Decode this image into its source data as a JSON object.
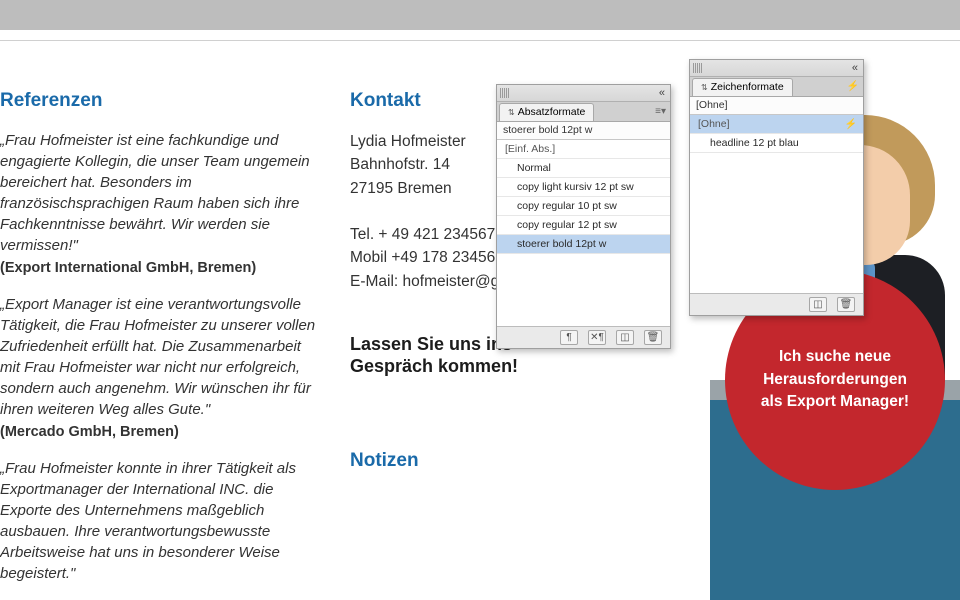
{
  "referenzen": {
    "heading": "Referenzen",
    "items": [
      {
        "text": "„Frau Hofmeister ist eine fachkundige und engagierte Kollegin, die unser Team ungemein bereichert hat. Besonders im französischsprachigen Raum haben sich ihre Fachkenntnisse bewährt. Wir werden sie vermissen!\"",
        "attr": "(Export International GmbH, Bremen)"
      },
      {
        "text": "„Export Manager ist eine verantwortungsvolle Tätigkeit, die Frau Hofmeister zu unserer vollen Zufriedenheit erfüllt hat. Die Zusammenarbeit mit Frau Hofmeister war nicht nur erfolgreich, sondern auch angenehm. Wir wünschen ihr für ihren weiteren Weg alles Gute.\"",
        "attr": "(Mercado GmbH, Bremen)"
      },
      {
        "text": "„Frau Hofmeister konnte in ihrer Tätigkeit als Exportmanager der International INC. die Exporte des Unternehmens maßgeblich ausbauen. Ihre verantwortungsbewusste Arbeitsweise hat uns in besonderer Weise begeistert.\"",
        "attr": ""
      }
    ]
  },
  "kontakt": {
    "heading": "Kontakt",
    "name": "Lydia Hofmeister",
    "street": "Bahnhofstr. 14",
    "city": "27195 Bremen",
    "tel": "Tel. + 49 421 234567",
    "mobil": "Mobil +49 178 2345678",
    "email": "E-Mail: hofmeister@gmx.",
    "cta_line1": "Lassen Sie uns ins",
    "cta_line2": "Gespräch kommen!"
  },
  "notizen": {
    "heading": "Notizen"
  },
  "callout": {
    "text": "Ich suche neue Herausforderungen als Export Manager!"
  },
  "panels": {
    "absatz": {
      "tab": "Absatzformate",
      "current": "stoerer bold 12pt w",
      "items": [
        {
          "label": "[Einf. Abs.]",
          "root": true
        },
        {
          "label": "Normal"
        },
        {
          "label": "copy light kursiv 12 pt sw"
        },
        {
          "label": "copy regular 10 pt sw"
        },
        {
          "label": "copy regular 12 pt sw"
        },
        {
          "label": "stoerer bold 12pt w",
          "selected": true
        }
      ]
    },
    "zeichen": {
      "tab": "Zeichenformate",
      "current": "[Ohne]",
      "items": [
        {
          "label": "[Ohne]",
          "root": true,
          "selected": true,
          "bolt": true
        },
        {
          "label": "headline  12 pt blau"
        }
      ]
    },
    "menu_glyph": "≡▾",
    "minimize_glyph": "«",
    "flash_glyph": "⚡",
    "updown_glyph": "⇅"
  },
  "footer_icons": {
    "new_para": "¶",
    "clear": "✕¶",
    "new": "◫",
    "trash": "🗑"
  }
}
